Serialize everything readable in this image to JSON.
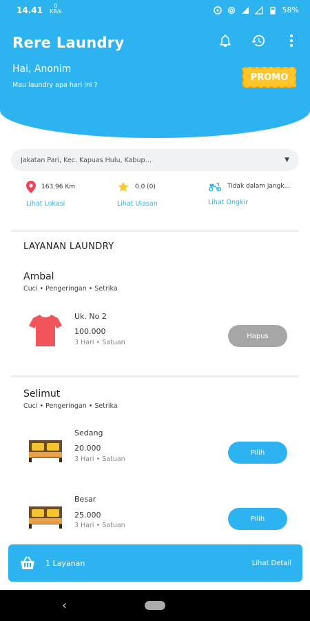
{
  "status": {
    "time": "14.41",
    "net_top": "0",
    "net_bottom": "KB/s",
    "battery": "58%"
  },
  "header": {
    "title": "Rere Laundry",
    "greeting": "Hai, Anonim",
    "subtitle": "Mau laundry apa hari ini ?",
    "promo_label": "PROMO"
  },
  "address": "Jakatan Pari, Kec. Kapuas Hulu, Kabupaten Kapuas, Kalimantan Tengah",
  "info": {
    "distance": "163.96 Km",
    "distance_link": "Lihat Lokasi",
    "rating": "0.0 (0)",
    "rating_link": "Lihat Ulasan",
    "delivery": "Tidak dalam jangk...",
    "delivery_link": "Lihat Ongkir"
  },
  "section_title": "LAYANAN LAUNDRY",
  "groups": [
    {
      "title": "Ambal",
      "subtitle": "Cuci • Pengeringan • Setrika",
      "items": [
        {
          "name": "Uk. No 2",
          "price": "100.000",
          "meta": "3 Hari  •  Satuan",
          "button": "Hapus"
        }
      ]
    },
    {
      "title": "Selimut",
      "subtitle": "Cuci • Pengeringan • Setrika",
      "items": [
        {
          "name": "Sedang",
          "price": "20.000",
          "meta": "3 Hari  •  Satuan",
          "button": "Pilih"
        },
        {
          "name": "Besar",
          "price": "25.000",
          "meta": "3 Hari  •  Satuan",
          "button": "Pilih"
        }
      ]
    }
  ],
  "cart": {
    "count": "1 Layanan",
    "detail": "Lihat Detail"
  },
  "colors": {
    "primary": "#2db3ef",
    "promo": "#ffc62b",
    "remove": "#a6a6a6"
  },
  "icons": [
    "bell-icon",
    "history-icon",
    "more-vert-icon",
    "location-pin-icon",
    "star-icon",
    "scooter-icon",
    "tshirt-icon",
    "bed-icon",
    "basket-icon"
  ]
}
